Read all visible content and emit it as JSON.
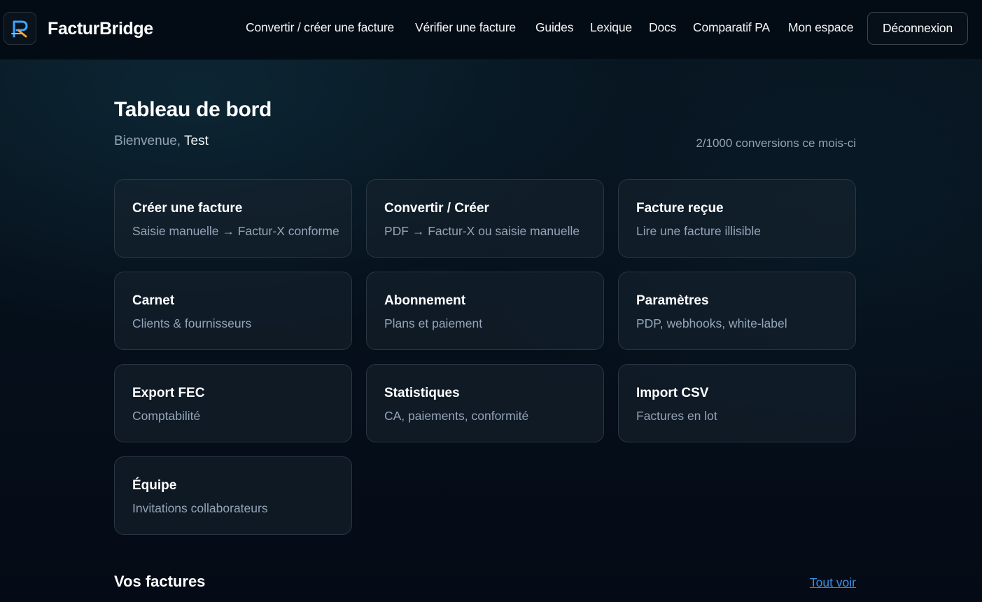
{
  "header": {
    "brand": "FacturBridge",
    "nav": [
      {
        "label": "Convertir / créer une facture"
      },
      {
        "label": "Vérifier une facture"
      },
      {
        "label": "Guides"
      },
      {
        "label": "Lexique"
      },
      {
        "label": "Docs"
      },
      {
        "label": "Comparatif PA"
      },
      {
        "label": "Mon espace"
      }
    ],
    "logout_label": "Déconnexion"
  },
  "dashboard": {
    "title": "Tableau de bord",
    "welcome_prefix": "Bienvenue,",
    "user_name": "Test",
    "usage": "2/1000 conversions ce mois-ci",
    "cards": [
      {
        "title": "Créer une facture",
        "subtitle": "Saisie manuelle → Factur-X conforme"
      },
      {
        "title": "Convertir / Créer",
        "subtitle": "PDF → Factur-X ou saisie manuelle"
      },
      {
        "title": "Facture reçue",
        "subtitle": "Lire une facture illisible"
      },
      {
        "title": "Carnet",
        "subtitle": "Clients & fournisseurs"
      },
      {
        "title": "Abonnement",
        "subtitle": "Plans et paiement"
      },
      {
        "title": "Paramètres",
        "subtitle": "PDP, webhooks, white-label"
      },
      {
        "title": "Export FEC",
        "subtitle": "Comptabilité"
      },
      {
        "title": "Statistiques",
        "subtitle": "CA, paiements, conformité"
      },
      {
        "title": "Import CSV",
        "subtitle": "Factures en lot"
      },
      {
        "title": "Équipe",
        "subtitle": "Invitations collaborateurs"
      }
    ]
  },
  "invoices": {
    "title": "Vos factures",
    "see_all": "Tout voir"
  },
  "colors": {
    "accent_link": "#3d8fe0",
    "logo_blue": "#3aa6ff",
    "logo_orange": "#f0a43a"
  },
  "icons": {
    "logo": "facturbridge-logo-icon"
  }
}
